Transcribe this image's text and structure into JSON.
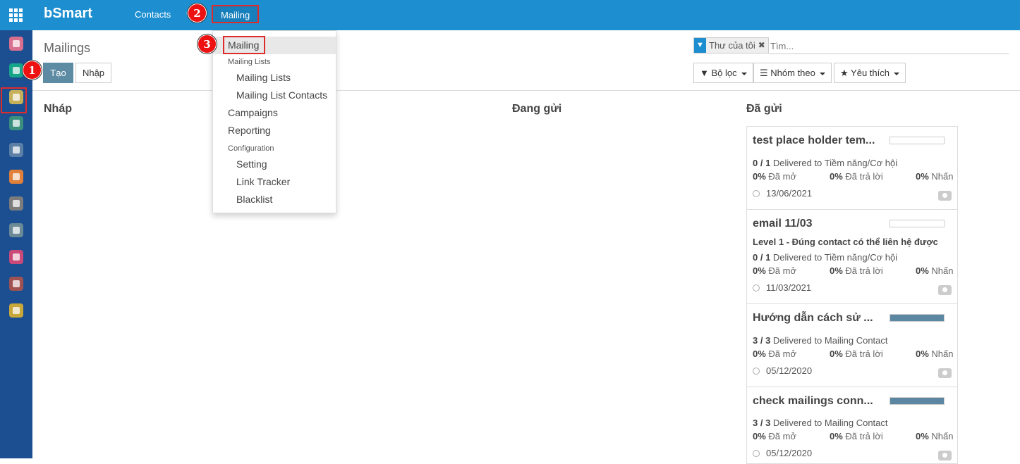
{
  "topbar": {
    "brand": "bSmart",
    "menu_contacts": "Contacts",
    "menu_mailing": "Mailing",
    "fragment": "C"
  },
  "sidebar": {
    "items": [
      {
        "icon": "chat-icon",
        "color": "#d96f8f"
      },
      {
        "icon": "email-marketing-icon",
        "color": "#17a589"
      },
      {
        "icon": "calendar-icon",
        "color": "#c6b05a"
      },
      {
        "icon": "contacts-icon",
        "color": "#3a8f7e"
      },
      {
        "icon": "handshake-icon",
        "color": "#5c7fa5"
      },
      {
        "icon": "website-icon",
        "color": "#e0803a"
      },
      {
        "icon": "link-icon",
        "color": "#7c7c7c"
      },
      {
        "icon": "send-icon",
        "color": "#6c8a96"
      },
      {
        "icon": "dashboard-icon",
        "color": "#c94a78"
      },
      {
        "icon": "apps-icon",
        "color": "#a05252"
      },
      {
        "icon": "settings-icon",
        "color": "#c9a83a"
      }
    ]
  },
  "markers": {
    "one": "1",
    "two": "2",
    "three": "3"
  },
  "control": {
    "title": "Mailings",
    "create_label": "Tạo",
    "import_label": "Nhập",
    "facet_label": "Thư của tôi",
    "search_placeholder": "Tìm...",
    "filter_label": "Bộ lọc",
    "groupby_label": "Nhóm theo",
    "favorites_label": "Yêu thích"
  },
  "columns": {
    "draft": "Nháp",
    "sending": "Đang gửi",
    "sent": "Đã gửi"
  },
  "cards": [
    {
      "title": "test place holder tem...",
      "subject": "",
      "delivered": "0 / 1",
      "delivered_to": "Delivered to Tiềm năng/Cơ hội",
      "opened": "0%",
      "opened_label": "Đã mở",
      "replied": "0%",
      "replied_label": "Đã trả lời",
      "clicked": "0%",
      "clicked_label": "Nhấn",
      "date": "13/06/2021",
      "progress": 0
    },
    {
      "title": "email 11/03",
      "subject": "Level 1 - Đúng contact có thể liên hệ được",
      "delivered": "0 / 1",
      "delivered_to": "Delivered to Tiềm năng/Cơ hội",
      "opened": "0%",
      "opened_label": "Đã mở",
      "replied": "0%",
      "replied_label": "Đã trả lời",
      "clicked": "0%",
      "clicked_label": "Nhấn",
      "date": "11/03/2021",
      "progress": 0
    },
    {
      "title": "Hướng dẫn cách sử ...",
      "subject": "",
      "delivered": "3 / 3",
      "delivered_to": "Delivered to Mailing Contact",
      "opened": "0%",
      "opened_label": "Đã mở",
      "replied": "0%",
      "replied_label": "Đã trả lời",
      "clicked": "0%",
      "clicked_label": "Nhấn",
      "date": "05/12/2020",
      "progress": 100
    },
    {
      "title": "check mailings conn...",
      "subject": "",
      "delivered": "3 / 3",
      "delivered_to": "Delivered to Mailing Contact",
      "opened": "0%",
      "opened_label": "Đã mở",
      "replied": "0%",
      "replied_label": "Đã trả lời",
      "clicked": "0%",
      "clicked_label": "Nhấn",
      "date": "05/12/2020",
      "progress": 100
    }
  ],
  "dropdown": {
    "mailing": "Mailing",
    "mailing_lists_header": "Mailing Lists",
    "mailing_lists": "Mailing Lists",
    "mailing_list_contacts": "Mailing List Contacts",
    "campaigns": "Campaigns",
    "reporting": "Reporting",
    "configuration_header": "Configuration",
    "setting": "Setting",
    "link_tracker": "Link Tracker",
    "blacklist": "Blacklist"
  }
}
